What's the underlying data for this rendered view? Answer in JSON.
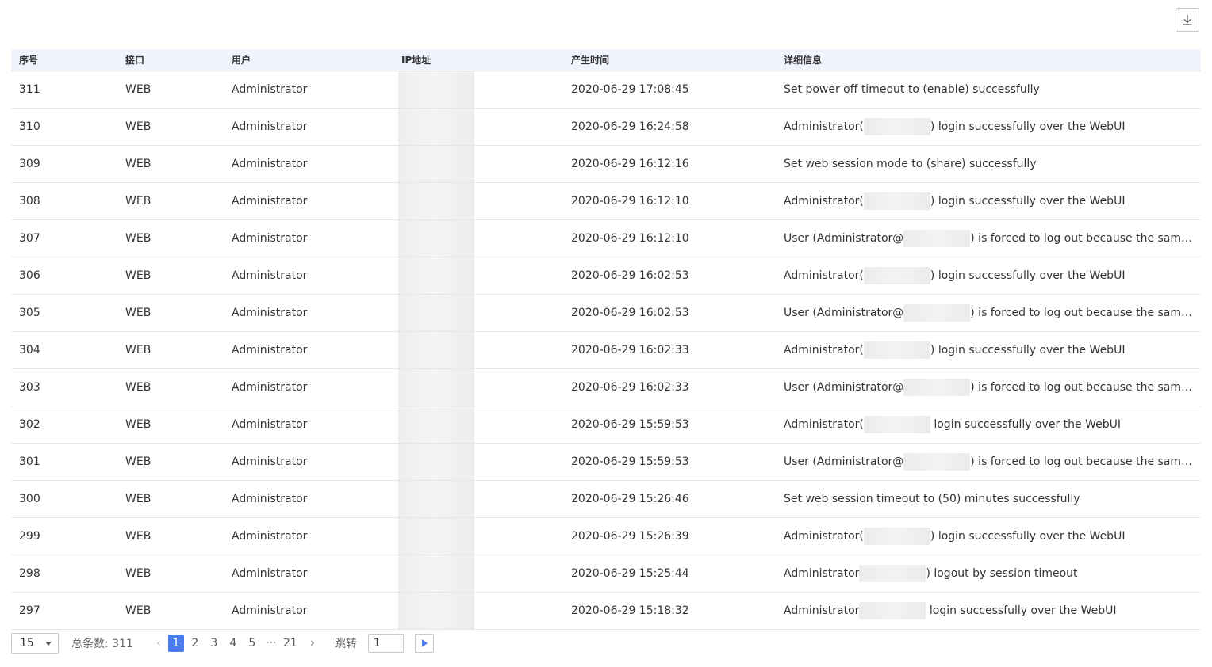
{
  "toolbar": {
    "download_icon": "download-icon"
  },
  "table": {
    "columns": [
      "序号",
      "接口",
      "用户",
      "IP地址",
      "产生时间",
      "详细信息"
    ],
    "rows": [
      {
        "id": "311",
        "interface": "WEB",
        "user": "Administrator",
        "time": "2020-06-29 17:08:45",
        "detail_pre": "Set power off timeout to (enable) successfully",
        "detail_post": ""
      },
      {
        "id": "310",
        "interface": "WEB",
        "user": "Administrator",
        "time": "2020-06-29 16:24:58",
        "detail_pre": "Administrator(",
        "detail_post": ") login successfully over the WebUI"
      },
      {
        "id": "309",
        "interface": "WEB",
        "user": "Administrator",
        "time": "2020-06-29 16:12:16",
        "detail_pre": "Set web session mode to (share) successfully",
        "detail_post": ""
      },
      {
        "id": "308",
        "interface": "WEB",
        "user": "Administrator",
        "time": "2020-06-29 16:12:10",
        "detail_pre": "Administrator(",
        "detail_post": ") login successfully over the WebUI"
      },
      {
        "id": "307",
        "interface": "WEB",
        "user": "Administrator",
        "time": "2020-06-29 16:12:10",
        "detail_pre": "User (Administrator@",
        "detail_post": ") is forced to log out because the same u..."
      },
      {
        "id": "306",
        "interface": "WEB",
        "user": "Administrator",
        "time": "2020-06-29 16:02:53",
        "detail_pre": "Administrator(",
        "detail_post": ") login successfully over the WebUI"
      },
      {
        "id": "305",
        "interface": "WEB",
        "user": "Administrator",
        "time": "2020-06-29 16:02:53",
        "detail_pre": "User (Administrator@",
        "detail_post": ") is forced to log out because the same us..."
      },
      {
        "id": "304",
        "interface": "WEB",
        "user": "Administrator",
        "time": "2020-06-29 16:02:33",
        "detail_pre": "Administrator(",
        "detail_post": ") login successfully over the WebUI"
      },
      {
        "id": "303",
        "interface": "WEB",
        "user": "Administrator",
        "time": "2020-06-29 16:02:33",
        "detail_pre": "User (Administrator@",
        "detail_post": ") is forced to log out because the same u..."
      },
      {
        "id": "302",
        "interface": "WEB",
        "user": "Administrator",
        "time": "2020-06-29 15:59:53",
        "detail_pre": "Administrator(",
        "detail_post": " login successfully over the WebUI"
      },
      {
        "id": "301",
        "interface": "WEB",
        "user": "Administrator",
        "time": "2020-06-29 15:59:53",
        "detail_pre": "User (Administrator@",
        "detail_post": ") is forced to log out because the same us..."
      },
      {
        "id": "300",
        "interface": "WEB",
        "user": "Administrator",
        "time": "2020-06-29 15:26:46",
        "detail_pre": "Set web session timeout to (50) minutes successfully",
        "detail_post": ""
      },
      {
        "id": "299",
        "interface": "WEB",
        "user": "Administrator",
        "time": "2020-06-29 15:26:39",
        "detail_pre": "Administrator(",
        "detail_post": ") login successfully over the WebUI"
      },
      {
        "id": "298",
        "interface": "WEB",
        "user": "Administrator",
        "time": "2020-06-29 15:25:44",
        "detail_pre": "Administrator",
        "detail_post": ") logout by session timeout"
      },
      {
        "id": "297",
        "interface": "WEB",
        "user": "Administrator",
        "time": "2020-06-29 15:18:32",
        "detail_pre": "Administrator",
        "detail_post": " login successfully over the WebUI"
      }
    ]
  },
  "pagination": {
    "page_size": "15",
    "total_label": "总条数: 311",
    "pages": [
      "1",
      "2",
      "3",
      "4",
      "5",
      "···",
      "21"
    ],
    "current_page": "1",
    "jump_label": "跳转",
    "jump_value": "1",
    "prev_icon": "chevron-left-icon",
    "next_icon": "chevron-right-icon",
    "go_icon": "play-icon"
  },
  "colors": {
    "accent": "#4b7bec",
    "header_bg": "#f0f4fc",
    "row_border": "#e3e6eb"
  }
}
